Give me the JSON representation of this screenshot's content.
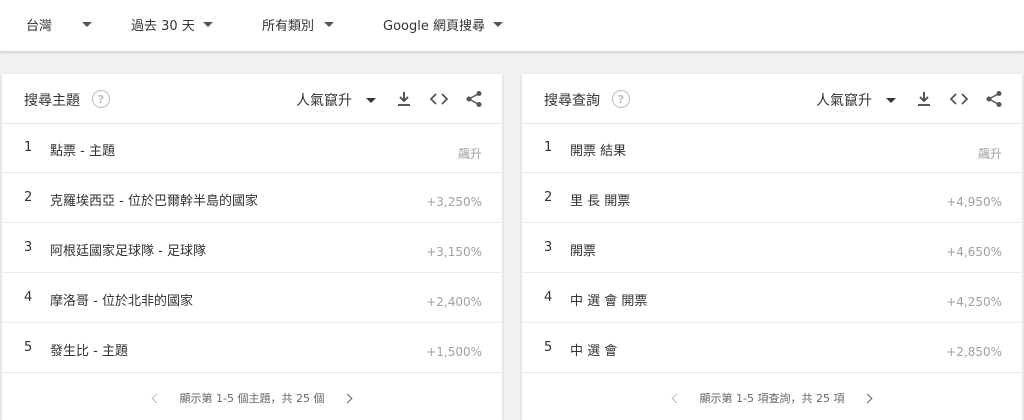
{
  "filters": {
    "region": "台灣",
    "time": "過去 30 天",
    "category": "所有類別",
    "search_type": "Google 網頁搜尋"
  },
  "topics": {
    "title": "搜尋主題",
    "sort": "人氣竄升",
    "rows": [
      {
        "rank": "1",
        "label": "點票 - 主題",
        "value": "飆升"
      },
      {
        "rank": "2",
        "label": "克羅埃西亞 - 位於巴爾幹半島的國家",
        "value": "+3,250%"
      },
      {
        "rank": "3",
        "label": "阿根廷國家足球隊 - 足球隊",
        "value": "+3,150%"
      },
      {
        "rank": "4",
        "label": "摩洛哥 - 位於北非的國家",
        "value": "+2,400%"
      },
      {
        "rank": "5",
        "label": "發生比 - 主題",
        "value": "+1,500%"
      }
    ],
    "footer": "顯示第 1-5 個主題，共 25 個"
  },
  "queries": {
    "title": "搜尋查詢",
    "sort": "人氣竄升",
    "rows": [
      {
        "rank": "1",
        "label": "開票 結果",
        "value": "飆升"
      },
      {
        "rank": "2",
        "label": "里 長 開票",
        "value": "+4,950%"
      },
      {
        "rank": "3",
        "label": "開票",
        "value": "+4,650%"
      },
      {
        "rank": "4",
        "label": "中 選 會 開票",
        "value": "+4,250%"
      },
      {
        "rank": "5",
        "label": "中 選 會",
        "value": "+2,850%"
      }
    ],
    "footer": "顯示第 1-5 項查詢，共 25 項"
  },
  "icons": {
    "help": "help-circle-icon",
    "download": "download-icon",
    "embed": "code-embed-icon",
    "share": "share-icon",
    "prev": "chevron-left-icon",
    "next": "chevron-right-icon"
  }
}
